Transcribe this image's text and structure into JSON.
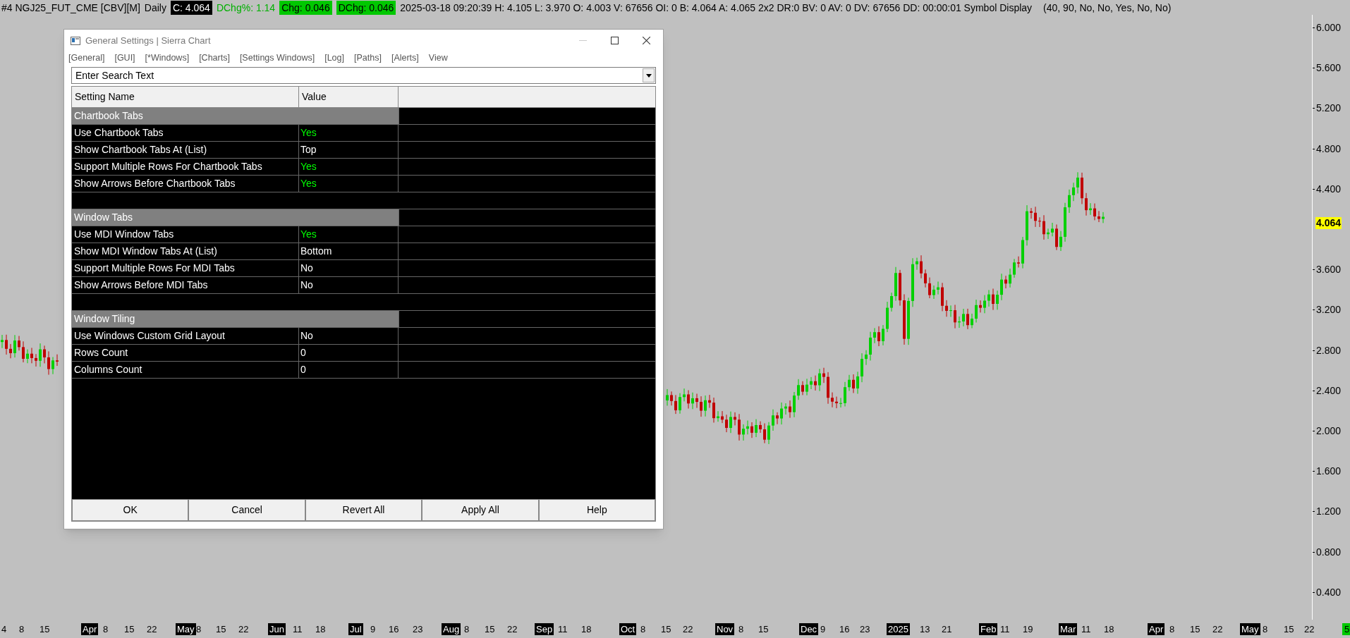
{
  "status_bar": {
    "fields": [
      {
        "text": "#4 NGJ25_FUT_CME [CBV][M]",
        "kind": "plain"
      },
      {
        "text": "Daily",
        "kind": "plain"
      },
      {
        "text": "C: 4.064",
        "kind": "inverse"
      },
      {
        "text": "DChg%: 1.14",
        "kind": "green_text"
      },
      {
        "text": "Chg: 0.046",
        "kind": "green_box"
      },
      {
        "text": "DChg: 0.046",
        "kind": "green_box"
      },
      {
        "text": "2025-03-18 09:20:39 H: 4.105 L: 3.970 O: 4.003 V: 67656 OI: 0 B: 4.064 A: 4.065 2x2 DR:0 BV: 0 AV: 0 DV: 67656 DD: 00:00:01 Symbol Display",
        "kind": "plain"
      },
      {
        "text": "(40, 90, No, No, Yes, No, No)",
        "kind": "plain"
      }
    ]
  },
  "price_axis": {
    "labels": [
      "6.000",
      "5.600",
      "5.200",
      "4.800",
      "4.400",
      "3.600",
      "3.200",
      "2.800",
      "2.400",
      "2.000",
      "1.600",
      "1.200",
      "0.800",
      "0.400"
    ],
    "last_price": "4.064"
  },
  "time_axis": {
    "labels": [
      {
        "text": "4",
        "kind": "day"
      },
      {
        "text": "8",
        "kind": "day"
      },
      {
        "text": "15",
        "kind": "day"
      },
      {
        "text": "Apr",
        "kind": "period"
      },
      {
        "text": "8",
        "kind": "day"
      },
      {
        "text": "15",
        "kind": "day"
      },
      {
        "text": "22",
        "kind": "day"
      },
      {
        "text": "May",
        "kind": "period"
      },
      {
        "text": "8",
        "kind": "day"
      },
      {
        "text": "15",
        "kind": "day"
      },
      {
        "text": "22",
        "kind": "day"
      },
      {
        "text": "Jun",
        "kind": "period"
      },
      {
        "text": "11",
        "kind": "day"
      },
      {
        "text": "18",
        "kind": "day"
      },
      {
        "text": "Jul",
        "kind": "period"
      },
      {
        "text": "9",
        "kind": "day"
      },
      {
        "text": "16",
        "kind": "day"
      },
      {
        "text": "23",
        "kind": "day"
      },
      {
        "text": "Aug",
        "kind": "period"
      },
      {
        "text": "8",
        "kind": "day"
      },
      {
        "text": "15",
        "kind": "day"
      },
      {
        "text": "22",
        "kind": "day"
      },
      {
        "text": "Sep",
        "kind": "period"
      },
      {
        "text": "11",
        "kind": "day"
      },
      {
        "text": "18",
        "kind": "day"
      },
      {
        "text": "Oct",
        "kind": "period"
      },
      {
        "text": "8",
        "kind": "day"
      },
      {
        "text": "15",
        "kind": "day"
      },
      {
        "text": "22",
        "kind": "day"
      },
      {
        "text": "Nov",
        "kind": "period"
      },
      {
        "text": "8",
        "kind": "day"
      },
      {
        "text": "15",
        "kind": "day"
      },
      {
        "text": "Dec",
        "kind": "period"
      },
      {
        "text": "9",
        "kind": "day"
      },
      {
        "text": "16",
        "kind": "day"
      },
      {
        "text": "23",
        "kind": "day"
      },
      {
        "text": "2025",
        "kind": "period"
      },
      {
        "text": "13",
        "kind": "day"
      },
      {
        "text": "21",
        "kind": "day"
      },
      {
        "text": "Feb",
        "kind": "period"
      },
      {
        "text": "11",
        "kind": "day"
      },
      {
        "text": "19",
        "kind": "day"
      },
      {
        "text": "Mar",
        "kind": "period"
      },
      {
        "text": "11",
        "kind": "day"
      },
      {
        "text": "18",
        "kind": "day"
      },
      {
        "text": "Apr",
        "kind": "period"
      },
      {
        "text": "8",
        "kind": "day"
      },
      {
        "text": "15",
        "kind": "day"
      },
      {
        "text": "22",
        "kind": "day"
      },
      {
        "text": "May",
        "kind": "period"
      },
      {
        "text": "8",
        "kind": "day"
      },
      {
        "text": "15",
        "kind": "day"
      },
      {
        "text": "22",
        "kind": "day"
      },
      {
        "text": "5",
        "kind": "counter"
      }
    ]
  },
  "dialog": {
    "title": "General Settings | Sierra Chart",
    "menu": [
      "[General]",
      "[GUI]",
      "[*Windows]",
      "[Charts]",
      "[Settings Windows]",
      "[Log]",
      "[Paths]",
      "[Alerts]",
      "View"
    ],
    "search": {
      "placeholder": "Enter Search Text"
    },
    "table": {
      "columns": [
        "Setting Name",
        "Value"
      ],
      "sections": [
        {
          "title": "Chartbook Tabs",
          "rows": [
            {
              "name": "Use Chartbook Tabs",
              "value": "Yes",
              "color": "#00ff00"
            },
            {
              "name": "Show Chartbook Tabs At (List)",
              "value": "Top",
              "color": "#ffffff"
            },
            {
              "name": "Support Multiple Rows For Chartbook Tabs",
              "value": "Yes",
              "color": "#00ff00"
            },
            {
              "name": "Show Arrows Before Chartbook Tabs",
              "value": "Yes",
              "color": "#00ff00"
            }
          ]
        },
        {
          "title": "Window Tabs",
          "rows": [
            {
              "name": "Use MDI Window Tabs",
              "value": "Yes",
              "color": "#00ff00"
            },
            {
              "name": "Show MDI Window Tabs At (List)",
              "value": "Bottom",
              "color": "#ffffff"
            },
            {
              "name": "Support Multiple Rows For MDI Tabs",
              "value": "No",
              "color": "#ffffff"
            },
            {
              "name": "Show Arrows Before MDI Tabs",
              "value": "No",
              "color": "#ffffff"
            }
          ]
        },
        {
          "title": "Window Tiling",
          "rows": [
            {
              "name": "Use Windows Custom Grid Layout",
              "value": "No",
              "color": "#ffffff"
            },
            {
              "name": "Rows Count",
              "value": "0",
              "color": "#ffffff"
            },
            {
              "name": "Columns Count",
              "value": "0",
              "color": "#ffffff"
            }
          ]
        }
      ]
    },
    "buttons": [
      "OK",
      "Cancel",
      "Revert All",
      "Apply All",
      "Help"
    ]
  }
}
